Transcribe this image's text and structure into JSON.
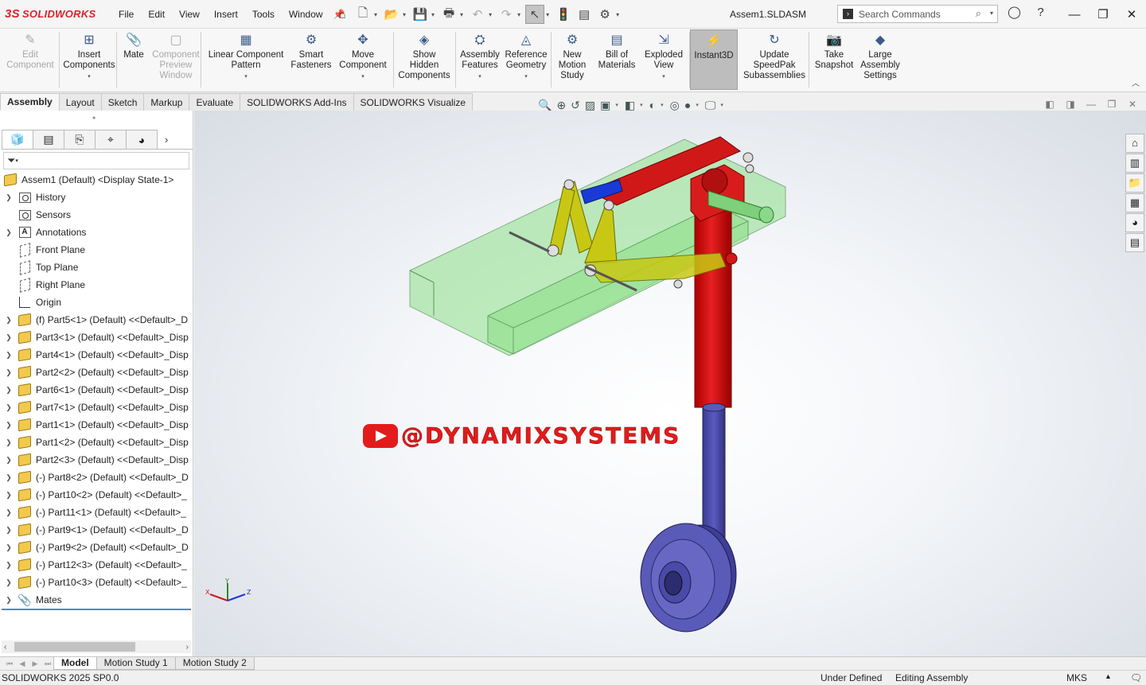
{
  "app": {
    "brand": "SOLIDWORKS",
    "brand_prefix": "3S",
    "document_title": "Assem1.SLDASM",
    "brand_color": "#d8232a"
  },
  "menu": [
    "File",
    "Edit",
    "View",
    "Insert",
    "Tools",
    "Window"
  ],
  "search": {
    "placeholder": "Search Commands"
  },
  "ribbon": {
    "buttons": [
      {
        "label": "Edit\nComponent",
        "enabled": false
      },
      {
        "label": "Insert\nComponents",
        "enabled": true
      },
      {
        "label": "Mate",
        "enabled": true
      },
      {
        "label": "Component\nPreview\nWindow",
        "enabled": false
      },
      {
        "label": "Linear Component\nPattern",
        "enabled": true
      },
      {
        "label": "Smart\nFasteners",
        "enabled": true
      },
      {
        "label": "Move\nComponent",
        "enabled": true
      },
      {
        "label": "Show\nHidden\nComponents",
        "enabled": true
      },
      {
        "label": "Assembly\nFeatures",
        "enabled": true
      },
      {
        "label": "Reference\nGeometry",
        "enabled": true
      },
      {
        "label": "New\nMotion\nStudy",
        "enabled": true
      },
      {
        "label": "Bill of\nMaterials",
        "enabled": true
      },
      {
        "label": "Exploded\nView",
        "enabled": true
      },
      {
        "label": "Instant3D",
        "enabled": true,
        "active": true
      },
      {
        "label": "Update\nSpeedPak\nSubassemblies",
        "enabled": true
      },
      {
        "label": "Take\nSnapshot",
        "enabled": true
      },
      {
        "label": "Large\nAssembly\nSettings",
        "enabled": true
      }
    ]
  },
  "tabs": [
    "Assembly",
    "Layout",
    "Sketch",
    "Markup",
    "Evaluate",
    "SOLIDWORKS Add-Ins",
    "SOLIDWORKS Visualize"
  ],
  "active_tab": "Assembly",
  "tree": {
    "root": "Assem1 (Default) <Display State-1>",
    "items": [
      {
        "label": "History",
        "icon": "history-icon",
        "expandable": true
      },
      {
        "label": "Sensors",
        "icon": "sensors-icon",
        "expandable": false
      },
      {
        "label": "Annotations",
        "icon": "annotations-icon",
        "expandable": true
      },
      {
        "label": "Front Plane",
        "icon": "plane-icon",
        "expandable": false
      },
      {
        "label": "Top Plane",
        "icon": "plane-icon",
        "expandable": false
      },
      {
        "label": "Right Plane",
        "icon": "plane-icon",
        "expandable": false
      },
      {
        "label": "Origin",
        "icon": "origin-icon",
        "expandable": false
      },
      {
        "label": "(f) Part5<1> (Default) <<Default>_D",
        "icon": "part-icon",
        "expandable": true
      },
      {
        "label": "Part3<1> (Default) <<Default>_Disp",
        "icon": "part-icon",
        "expandable": true
      },
      {
        "label": "Part4<1> (Default) <<Default>_Disp",
        "icon": "part-icon",
        "expandable": true
      },
      {
        "label": "Part2<2> (Default) <<Default>_Disp",
        "icon": "part-icon",
        "expandable": true
      },
      {
        "label": "Part6<1> (Default) <<Default>_Disp",
        "icon": "part-icon",
        "expandable": true
      },
      {
        "label": "Part7<1> (Default) <<Default>_Disp",
        "icon": "part-icon",
        "expandable": true
      },
      {
        "label": "Part1<1> (Default) <<Default>_Disp",
        "icon": "part-icon",
        "expandable": true
      },
      {
        "label": "Part1<2> (Default) <<Default>_Disp",
        "icon": "part-icon",
        "expandable": true
      },
      {
        "label": "Part2<3> (Default) <<Default>_Disp",
        "icon": "part-icon",
        "expandable": true
      },
      {
        "label": "(-) Part8<2> (Default) <<Default>_D",
        "icon": "part-icon",
        "expandable": true
      },
      {
        "label": "(-) Part10<2> (Default) <<Default>_",
        "icon": "part-icon",
        "expandable": true
      },
      {
        "label": "(-) Part11<1> (Default) <<Default>_",
        "icon": "part-icon",
        "expandable": true
      },
      {
        "label": "(-) Part9<1> (Default) <<Default>_D",
        "icon": "part-icon",
        "expandable": true
      },
      {
        "label": "(-) Part9<2> (Default) <<Default>_D",
        "icon": "part-icon",
        "expandable": true
      },
      {
        "label": "(-) Part12<3> (Default) <<Default>_",
        "icon": "part-icon",
        "expandable": true
      },
      {
        "label": "(-) Part10<3> (Default) <<Default>_",
        "icon": "part-icon",
        "expandable": true
      },
      {
        "label": "Mates",
        "icon": "mates-icon",
        "expandable": true
      }
    ]
  },
  "watermark": "@DYNAMIXSYSTEMS",
  "triad": {
    "x": "X",
    "y": "Y",
    "z": "Z"
  },
  "bottom_tabs": [
    "Model",
    "Motion Study 1",
    "Motion Study 2"
  ],
  "active_bottom_tab": "Model",
  "status": {
    "version": "SOLIDWORKS 2025 SP0.0",
    "definition": "Under Defined",
    "mode": "Editing Assembly",
    "units": "MKS"
  },
  "colors": {
    "frame": "#8ee08a",
    "link": "#c8c814",
    "arm": "#d01818",
    "strut": "#4a4aa8",
    "wheel": "#5a5ab8",
    "blue_pin": "#1a3ad8"
  }
}
